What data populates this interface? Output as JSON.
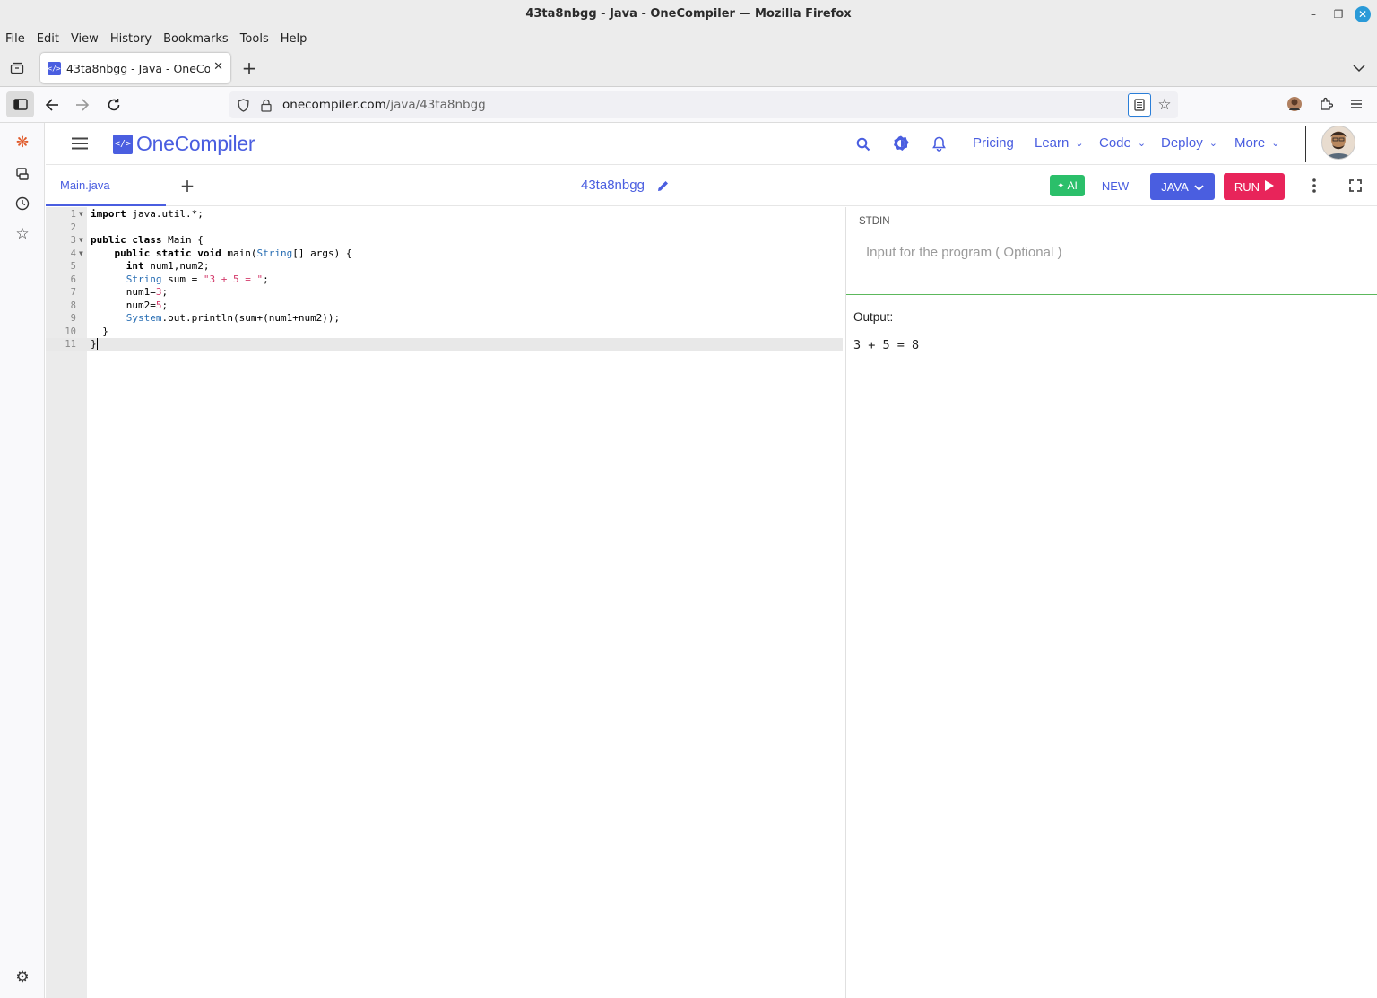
{
  "window": {
    "title": "43ta8nbgg - Java - OneCompiler — Mozilla Firefox"
  },
  "menu": [
    "File",
    "Edit",
    "View",
    "History",
    "Bookmarks",
    "Tools",
    "Help"
  ],
  "browser_tab": {
    "title": "43ta8nbgg - Java - OneCom",
    "favicon": "</>"
  },
  "url": {
    "domain": "onecompiler.com",
    "path": "/java/43ta8nbgg"
  },
  "site": {
    "logo_mark": "</>",
    "logo_text": "OneCompiler",
    "nav": {
      "pricing": "Pricing",
      "learn": "Learn",
      "code": "Code",
      "deploy": "Deploy",
      "more": "More"
    }
  },
  "editor": {
    "file_tab": "Main.java",
    "project_name": "43ta8nbgg",
    "ai_label": "AI",
    "new_label": "NEW",
    "language": "JAVA",
    "run_label": "RUN",
    "lines": [
      "import java.util.*;",
      "",
      "public class Main {",
      "    public static void main(String[] args) {",
      "      int num1,num2;",
      "      String sum = \"3 + 5 = \";",
      "      num1=3;",
      "      num2=5;",
      "      System.out.println(sum+(num1+num2));",
      "  }",
      "}"
    ]
  },
  "io": {
    "stdin_label": "STDIN",
    "stdin_placeholder": "Input for the program ( Optional )",
    "output_label": "Output:",
    "output_text": "3 + 5 = 8"
  },
  "colors": {
    "brand": "#4a5ee0",
    "run": "#e8245a",
    "ai": "#2bbf6a"
  }
}
